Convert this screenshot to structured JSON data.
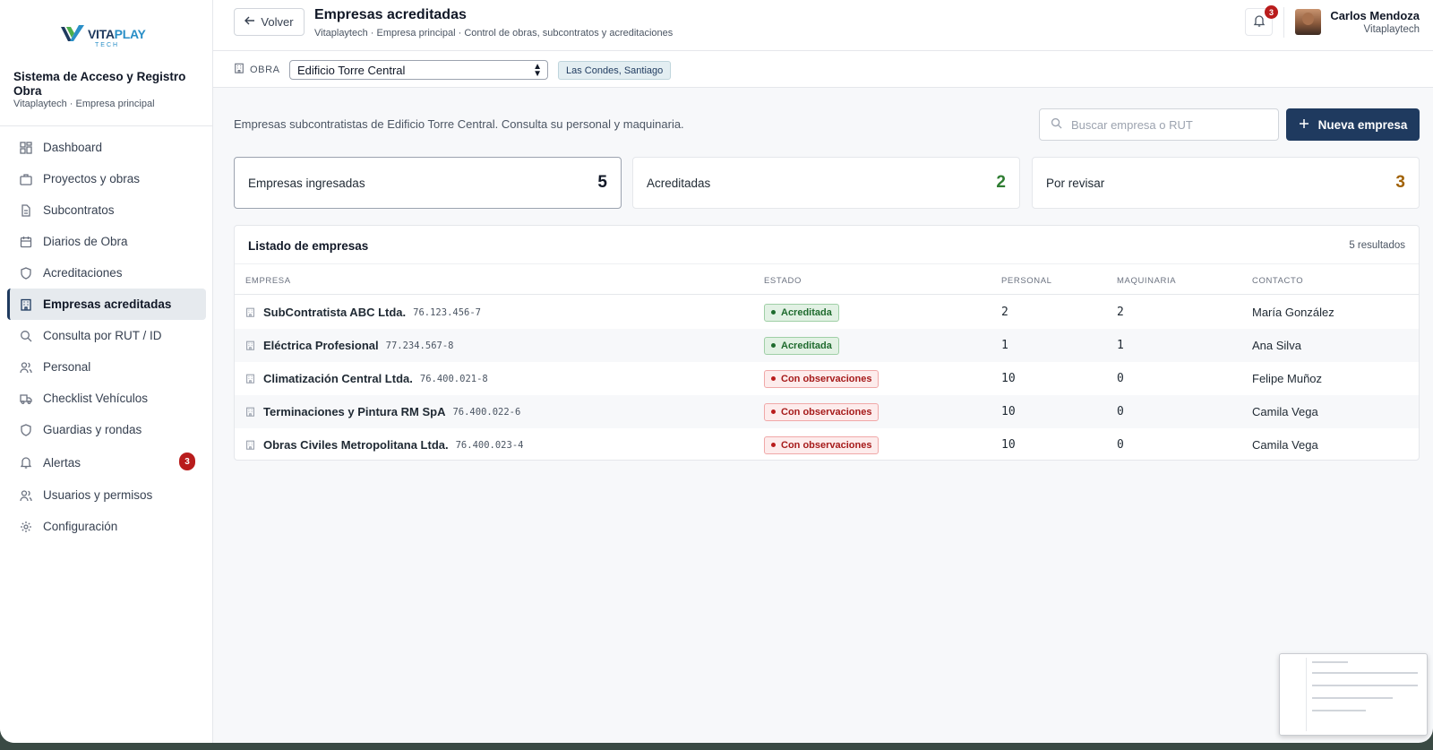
{
  "brand": {
    "logo_main": "VITA",
    "logo_accent": "PLAY",
    "logo_sub": "TECH"
  },
  "sidebar": {
    "system_title": "Sistema de Acceso y Registro Obra",
    "system_sub": "Vitaplaytech · Empresa principal",
    "items": [
      {
        "label": "Dashboard",
        "icon": "grid-icon"
      },
      {
        "label": "Proyectos y obras",
        "icon": "briefcase-icon"
      },
      {
        "label": "Subcontratos",
        "icon": "document-icon"
      },
      {
        "label": "Diarios de Obra",
        "icon": "calendar-icon"
      },
      {
        "label": "Acreditaciones",
        "icon": "shield-icon"
      },
      {
        "label": "Empresas acreditadas",
        "icon": "building-icon",
        "active": true
      },
      {
        "label": "Consulta por RUT / ID",
        "icon": "search-icon"
      },
      {
        "label": "Personal",
        "icon": "users-icon"
      },
      {
        "label": "Checklist Vehículos",
        "icon": "truck-icon"
      },
      {
        "label": "Guardias y rondas",
        "icon": "shield-icon"
      },
      {
        "label": "Alertas",
        "icon": "bell-icon",
        "badge": "3"
      },
      {
        "label": "Usuarios y permisos",
        "icon": "users-icon"
      },
      {
        "label": "Configuración",
        "icon": "gear-icon"
      }
    ]
  },
  "header": {
    "back_label": "Volver",
    "title": "Empresas acreditadas",
    "subtitle": "Vitaplaytech · Empresa principal · Control de obras, subcontratos y acreditaciones",
    "notifications": "3",
    "user_name": "Carlos Mendoza",
    "user_org": "Vitaplaytech"
  },
  "obra": {
    "label": "OBRA",
    "selected": "Edificio Torre Central",
    "location": "Las Condes, Santiago"
  },
  "main": {
    "intro": "Empresas subcontratistas de Edificio Torre Central. Consulta su personal y maquinaria.",
    "search_placeholder": "Buscar empresa o RUT",
    "new_button": "Nueva empresa",
    "stats": [
      {
        "label": "Empresas ingresadas",
        "value": "5",
        "color": "#111827"
      },
      {
        "label": "Acreditadas",
        "value": "2",
        "color": "#2f7d32"
      },
      {
        "label": "Por revisar",
        "value": "3",
        "color": "#a16207"
      }
    ]
  },
  "table": {
    "title": "Listado de empresas",
    "count": "5 resultados",
    "columns": [
      "EMPRESA",
      "ESTADO",
      "PERSONAL",
      "MAQUINARIA",
      "CONTACTO"
    ],
    "rows": [
      {
        "name": "SubContratista ABC Ltda.",
        "rut": "76.123.456-7",
        "status": "Acreditada",
        "status_type": "ok",
        "personal": "2",
        "maquinaria": "2",
        "contact": "María González"
      },
      {
        "name": "Eléctrica Profesional",
        "rut": "77.234.567-8",
        "status": "Acreditada",
        "status_type": "ok",
        "personal": "1",
        "maquinaria": "1",
        "contact": "Ana Silva"
      },
      {
        "name": "Climatización Central Ltda.",
        "rut": "76.400.021-8",
        "status": "Con observaciones",
        "status_type": "warn",
        "personal": "10",
        "maquinaria": "0",
        "contact": "Felipe Muñoz"
      },
      {
        "name": "Terminaciones y Pintura RM SpA",
        "rut": "76.400.022-6",
        "status": "Con observaciones",
        "status_type": "warn",
        "personal": "10",
        "maquinaria": "0",
        "contact": "Camila Vega"
      },
      {
        "name": "Obras Civiles Metropolitana Ltda.",
        "rut": "76.400.023-4",
        "status": "Con observaciones",
        "status_type": "warn",
        "personal": "10",
        "maquinaria": "0",
        "contact": "Camila Vega"
      }
    ]
  }
}
